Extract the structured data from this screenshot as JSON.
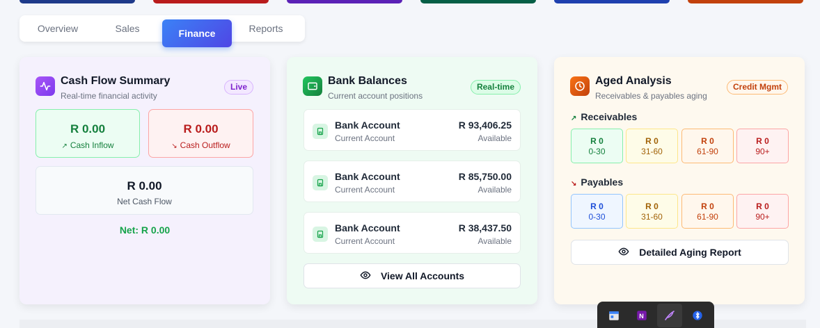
{
  "top_strip_colors": [
    "#1e3a8a",
    "#b91c1c",
    "#5b21b6",
    "#065f46",
    "#1e40af",
    "#c2410c"
  ],
  "tabs": [
    {
      "label": "Overview",
      "active": false
    },
    {
      "label": "Sales",
      "active": false
    },
    {
      "label": "Finance",
      "active": true
    },
    {
      "label": "Reports",
      "active": false
    }
  ],
  "cash_flow": {
    "title": "Cash Flow Summary",
    "subtitle": "Real-time financial activity",
    "badge": "Live",
    "inflow_value": "R 0.00",
    "inflow_label": "Cash Inflow",
    "outflow_value": "R 0.00",
    "outflow_label": "Cash Outflow",
    "net_value": "R 0.00",
    "net_label": "Net Cash Flow",
    "net_summary": "Net: R 0.00",
    "icon": "activity-icon"
  },
  "bank": {
    "title": "Bank Balances",
    "subtitle": "Current account positions",
    "badge": "Real-time",
    "icon": "wallet-icon",
    "accounts": [
      {
        "name": "Bank Account",
        "type": "Current Account",
        "amount": "R 93,406.25",
        "status": "Available"
      },
      {
        "name": "Bank Account",
        "type": "Current Account",
        "amount": "R 85,750.00",
        "status": "Available"
      },
      {
        "name": "Bank Account",
        "type": "Current Account",
        "amount": "R 38,437.50",
        "status": "Available"
      }
    ],
    "view_all": "View All Accounts"
  },
  "aged": {
    "title": "Aged Analysis",
    "subtitle": "Receivables & payables aging",
    "badge": "Credit Mgmt",
    "icon": "clock-icon",
    "receivables_label": "Receivables",
    "payables_label": "Payables",
    "receivables": [
      {
        "value": "R 0",
        "range": "0-30"
      },
      {
        "value": "R 0",
        "range": "31-60"
      },
      {
        "value": "R 0",
        "range": "61-90"
      },
      {
        "value": "R 0",
        "range": "90+"
      }
    ],
    "payables": [
      {
        "value": "R 0",
        "range": "0-30"
      },
      {
        "value": "R 0",
        "range": "31-60"
      },
      {
        "value": "R 0",
        "range": "61-90"
      },
      {
        "value": "R 0",
        "range": "90+"
      }
    ],
    "report_button": "Detailed Aging Report"
  },
  "taskbar": {
    "icons": [
      "calendar-app-icon",
      "onenote-icon",
      "feather-app-icon",
      "bluetooth-icon"
    ]
  }
}
